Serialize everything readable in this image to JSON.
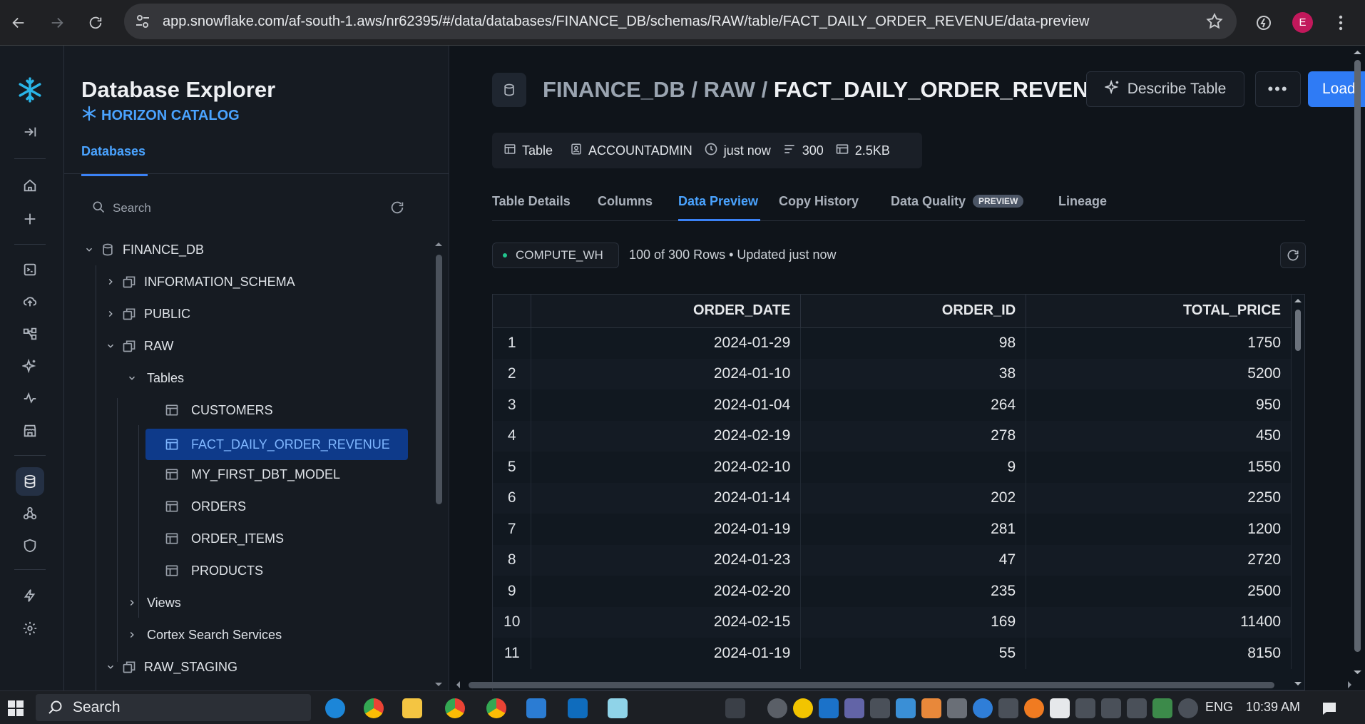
{
  "browser": {
    "url": "app.snowflake.com/af-south-1.aws/nr62395/#/data/databases/FINANCE_DB/schemas/RAW/table/FACT_DAILY_ORDER_REVENUE/data-preview",
    "profile_initial": "E"
  },
  "explorer": {
    "title": "Database Explorer",
    "catalog": "HORIZON CATALOG",
    "tab": "Databases",
    "search_placeholder": "Search",
    "tree": [
      {
        "label": "FINANCE_DB"
      },
      {
        "label": "INFORMATION_SCHEMA"
      },
      {
        "label": "PUBLIC"
      },
      {
        "label": "RAW"
      },
      {
        "label": "Tables"
      },
      {
        "label": "CUSTOMERS"
      },
      {
        "label": "FACT_DAILY_ORDER_REVENUE"
      },
      {
        "label": "MY_FIRST_DBT_MODEL"
      },
      {
        "label": "ORDERS"
      },
      {
        "label": "ORDER_ITEMS"
      },
      {
        "label": "PRODUCTS"
      },
      {
        "label": "Views"
      },
      {
        "label": "Cortex Search Services"
      },
      {
        "label": "RAW_STAGING"
      }
    ]
  },
  "header": {
    "crumb_db": "FINANCE_DB",
    "crumb_schema": "RAW",
    "sep": "/",
    "table": "FACT_DAILY_ORDER_REVENUE",
    "describe_label": "Describe Table",
    "more_label": "•••",
    "load_label": "Load"
  },
  "meta": {
    "type": "Table",
    "owner": "ACCOUNTADMIN",
    "updated": "just now",
    "rows": "300",
    "size": "2.5KB"
  },
  "tabs": [
    "Table Details",
    "Columns",
    "Data Preview",
    "Copy History",
    "Data Quality",
    "Lineage"
  ],
  "preview_badge": "PREVIEW",
  "active_tab": "Data Preview",
  "preview": {
    "warehouse": "COMPUTE_WH",
    "status": "100 of 300 Rows • Updated just now"
  },
  "grid": {
    "columns": [
      "ORDER_DATE",
      "ORDER_ID",
      "TOTAL_PRICE"
    ],
    "rows": [
      [
        "1",
        "2024-01-29",
        "98",
        "1750"
      ],
      [
        "2",
        "2024-01-10",
        "38",
        "5200"
      ],
      [
        "3",
        "2024-01-04",
        "264",
        "950"
      ],
      [
        "4",
        "2024-02-19",
        "278",
        "450"
      ],
      [
        "5",
        "2024-02-10",
        "9",
        "1550"
      ],
      [
        "6",
        "2024-01-14",
        "202",
        "2250"
      ],
      [
        "7",
        "2024-01-19",
        "281",
        "1200"
      ],
      [
        "8",
        "2024-01-23",
        "47",
        "2720"
      ],
      [
        "9",
        "2024-02-20",
        "235",
        "2500"
      ],
      [
        "10",
        "2024-02-15",
        "169",
        "11400"
      ],
      [
        "11",
        "2024-01-19",
        "55",
        "8150"
      ]
    ]
  },
  "taskbar": {
    "search": "Search",
    "lang": "ENG",
    "time": "10:39 AM"
  },
  "colors": {
    "accent": "#3b82f6",
    "selected_bg": "#0e3a8a",
    "warehouse_dot": "#21c48d"
  }
}
